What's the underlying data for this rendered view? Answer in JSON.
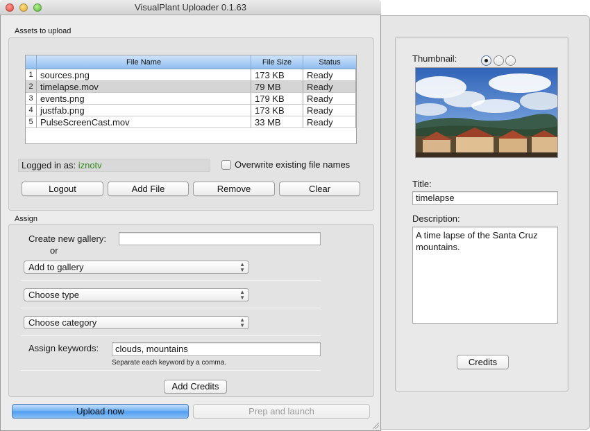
{
  "window": {
    "title": "VisualPlant Uploader 0.1.63"
  },
  "assets": {
    "section_label": "Assets to upload",
    "columns": {
      "name": "File Name",
      "size": "File Size",
      "status": "Status"
    },
    "rows": [
      {
        "num": "1",
        "name": "sources.png",
        "size": "173 KB",
        "status": "Ready",
        "selected": false
      },
      {
        "num": "2",
        "name": "timelapse.mov",
        "size": "79 MB",
        "status": "Ready",
        "selected": true
      },
      {
        "num": "3",
        "name": "events.png",
        "size": "179 KB",
        "status": "Ready",
        "selected": false
      },
      {
        "num": "4",
        "name": "justfab.png",
        "size": "173 KB",
        "status": "Ready",
        "selected": false
      },
      {
        "num": "5",
        "name": "PulseScreenCast.mov",
        "size": "33 MB",
        "status": "Ready",
        "selected": false
      }
    ],
    "logged_in_label": "Logged in as:",
    "logged_in_user": "iznotv",
    "overwrite_label": "Overwrite existing file names",
    "overwrite_checked": false,
    "buttons": {
      "logout": "Logout",
      "add_file": "Add File",
      "remove": "Remove",
      "clear": "Clear"
    }
  },
  "assign": {
    "section_label": "Assign",
    "new_gallery_label": "Create new gallery:",
    "new_gallery_value": "",
    "or_label": "or",
    "gallery_select": "Add to gallery",
    "type_select": "Choose type",
    "category_select": "Choose category",
    "keywords_label": "Assign keywords:",
    "keywords_value": "clouds, mountains",
    "keywords_hint": "Separate each keyword by a comma.",
    "add_credits": "Add Credits"
  },
  "footer": {
    "upload": "Upload now",
    "prep": "Prep and launch"
  },
  "drawer": {
    "thumbnail_label": "Thumbnail:",
    "thumbnail_selected_index": 0,
    "title_label": "Title:",
    "title_value": "timelapse",
    "description_label": "Description:",
    "description_value": "A time lapse of the Santa Cruz mountains.",
    "credits_button": "Credits"
  },
  "colors": {
    "username": "#2e8b1a",
    "accent": "#5aa2ef"
  }
}
